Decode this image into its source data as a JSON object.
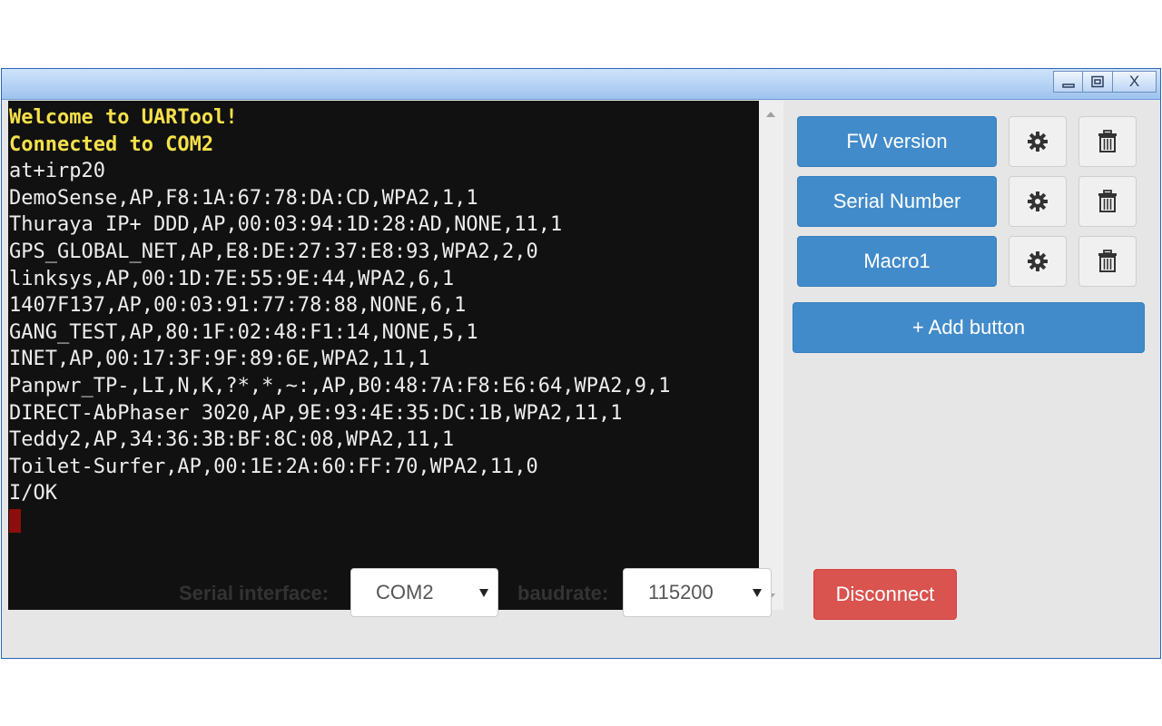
{
  "window": {
    "minimize_icon": "minimize-icon",
    "maximize_icon": "maximize-icon",
    "close_label": "X"
  },
  "terminal": {
    "lines": [
      {
        "text": "Welcome to UARTool!",
        "highlight": true
      },
      {
        "text": "Connected to COM2",
        "highlight": true
      },
      {
        "text": "at+irp20",
        "highlight": false
      },
      {
        "text": "DemoSense,AP,F8:1A:67:78:DA:CD,WPA2,1,1",
        "highlight": false
      },
      {
        "text": "Thuraya IP+ DDD,AP,00:03:94:1D:28:AD,NONE,11,1",
        "highlight": false
      },
      {
        "text": "GPS_GLOBAL_NET,AP,E8:DE:27:37:E8:93,WPA2,2,0",
        "highlight": false
      },
      {
        "text": "linksys,AP,00:1D:7E:55:9E:44,WPA2,6,1",
        "highlight": false
      },
      {
        "text": "1407F137,AP,00:03:91:77:78:88,NONE,6,1",
        "highlight": false
      },
      {
        "text": "GANG_TEST,AP,80:1F:02:48:F1:14,NONE,5,1",
        "highlight": false
      },
      {
        "text": "INET,AP,00:17:3F:9F:89:6E,WPA2,11,1",
        "highlight": false
      },
      {
        "text": "Panpwr_TP-,LI,N,K,?*,*,~:,AP,B0:48:7A:F8:E6:64,WPA2,9,1",
        "highlight": false
      },
      {
        "text": "DIRECT-AbPhaser 3020,AP,9E:93:4E:35:DC:1B,WPA2,11,1",
        "highlight": false
      },
      {
        "text": "Teddy2,AP,34:36:3B:BF:8C:08,WPA2,11,1",
        "highlight": false
      },
      {
        "text": "Toilet-Surfer,AP,00:1E:2A:60:FF:70,WPA2,11,0",
        "highlight": false
      },
      {
        "text": "I/OK",
        "highlight": false
      }
    ],
    "colors": {
      "background": "#111111",
      "text": "#ededed",
      "highlight": "#f6e04a",
      "cursor": "#8c0e0e"
    }
  },
  "macros": [
    {
      "label": "FW version",
      "settings_icon": "gear-icon",
      "delete_icon": "trash-icon"
    },
    {
      "label": "Serial Number",
      "settings_icon": "gear-icon",
      "delete_icon": "trash-icon"
    },
    {
      "label": "Macro1",
      "settings_icon": "gear-icon",
      "delete_icon": "trash-icon"
    }
  ],
  "add_button_label": "+ Add button",
  "bottom": {
    "serial_label": "Serial interface:",
    "serial_value": "COM2",
    "baud_label": "baudrate:",
    "baud_value": "115200",
    "disconnect_label": "Disconnect"
  },
  "colors": {
    "primary": "#428bca",
    "danger": "#d9534f",
    "window_bg": "#e6e6e6"
  }
}
